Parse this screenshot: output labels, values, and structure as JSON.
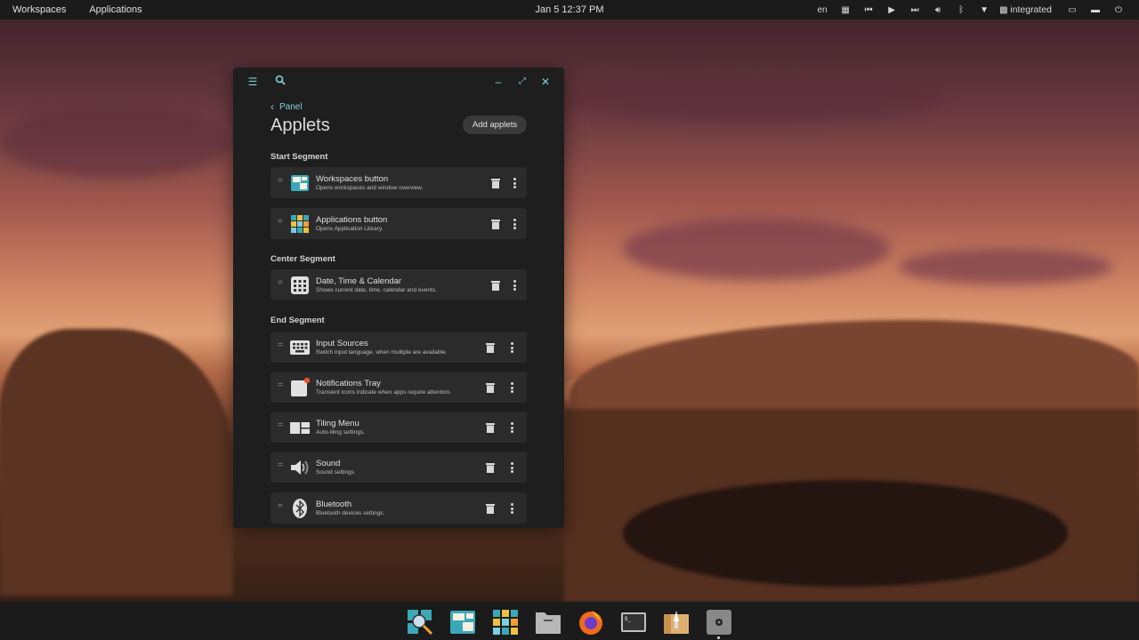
{
  "topbar": {
    "left": [
      "Workspaces",
      "Applications"
    ],
    "clock": "Jan 5 12:37 PM",
    "lang": "en",
    "gpu": "integrated",
    "icons": [
      "tiling-icon",
      "previous-track-icon",
      "play-icon",
      "next-track-icon",
      "volume-icon",
      "bluetooth-icon",
      "wifi-icon",
      "gpu-icon",
      "battery-icon",
      "notifications-icon",
      "power-icon"
    ]
  },
  "window": {
    "back_label": "Panel",
    "title": "Applets",
    "add_button": "Add applets",
    "segments": [
      {
        "label": "Start Segment",
        "items": [
          {
            "name": "Workspaces button",
            "desc": "Opens workspaces and window overview.",
            "icon": "workspaces-icon"
          },
          {
            "name": "Applications button",
            "desc": "Opens Application Library.",
            "icon": "applications-icon"
          }
        ]
      },
      {
        "label": "Center Segment",
        "items": [
          {
            "name": "Date, Time & Calendar",
            "desc": "Shows current date, time, calendar and events.",
            "icon": "calendar-icon"
          }
        ]
      },
      {
        "label": "End Segment",
        "items": [
          {
            "name": "Input Sources",
            "desc": "Switch input language, when multiple are available.",
            "icon": "keyboard-icon"
          },
          {
            "name": "Notifications Tray",
            "desc": "Transient icons indicate when apps require attention.",
            "icon": "notification-icon"
          },
          {
            "name": "Tiling Menu",
            "desc": "Auto-tiling settings.",
            "icon": "tiling-icon"
          },
          {
            "name": "Sound",
            "desc": "Sound settings",
            "icon": "sound-icon"
          },
          {
            "name": "Bluetooth",
            "desc": "Bluetooth devices settings.",
            "icon": "bluetooth-icon"
          }
        ]
      }
    ]
  },
  "dock": [
    "launcher",
    "workspaces",
    "applications",
    "files",
    "firefox",
    "terminal",
    "shop",
    "settings"
  ],
  "colors": {
    "accent": "#7fd1d8",
    "notification_dot": "#e8532a"
  }
}
